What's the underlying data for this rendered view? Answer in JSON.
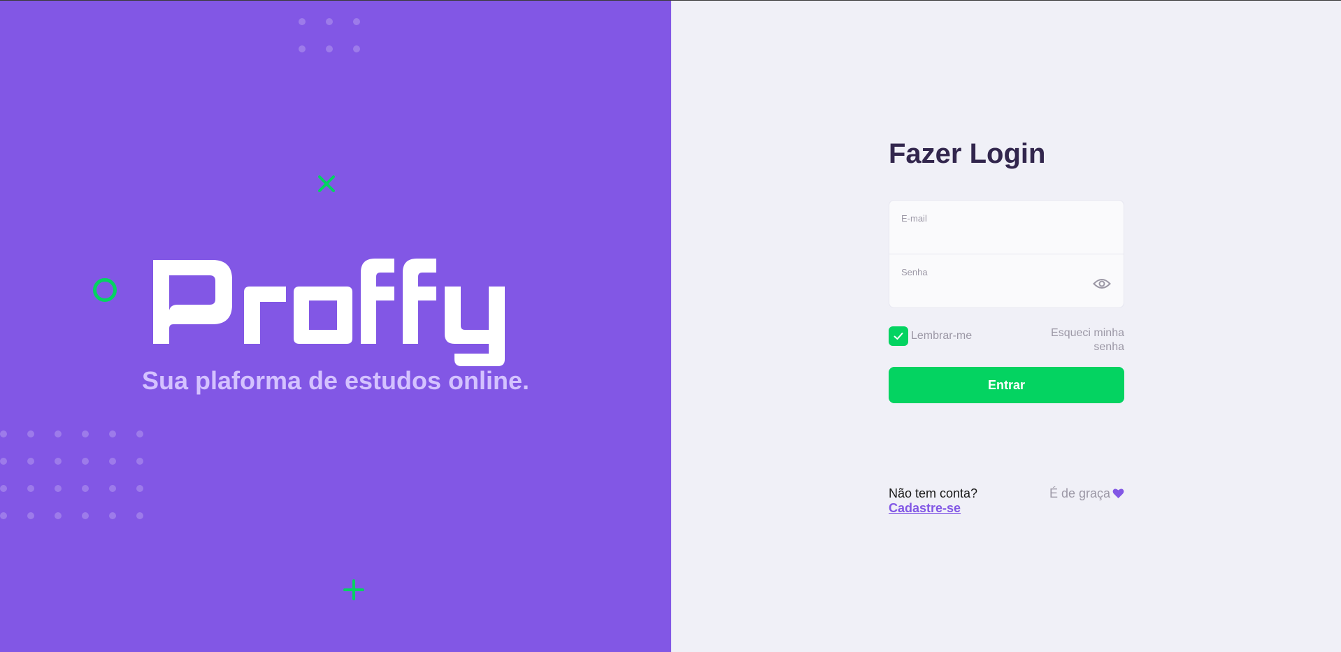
{
  "brand": {
    "logo_text": "Proffy",
    "tagline": "Sua plaforma de estudos online."
  },
  "login": {
    "title": "Fazer Login",
    "email_label": "E-mail",
    "email_value": "",
    "password_label": "Senha",
    "password_value": "",
    "remember_label": "Lembrar-me",
    "remember_checked": true,
    "forgot_label": "Esqueci minha senha",
    "submit_label": "Entrar"
  },
  "footer": {
    "no_account": "Não tem conta?",
    "signup": "Cadastre-se",
    "free": "É de graça"
  },
  "icons": {
    "password_toggle": "eye-icon",
    "checkbox": "check-icon",
    "free": "heart-icon"
  },
  "colors": {
    "primary": "#8257e5",
    "secondary": "#04d361",
    "title": "#32264d",
    "muted": "#9c98a6",
    "background": "#f0f0f7"
  }
}
